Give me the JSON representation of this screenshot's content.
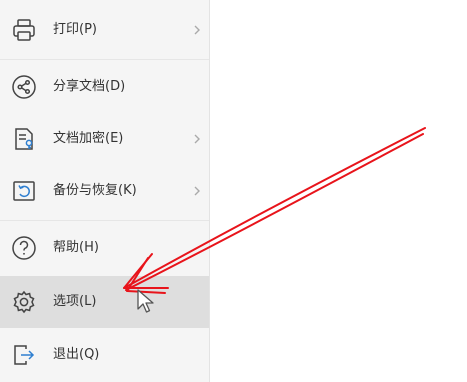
{
  "menu": {
    "items": [
      {
        "label": "打印(P)",
        "icon": "printer-icon",
        "has_submenu": true
      },
      {
        "label": "分享文档(D)",
        "icon": "share-icon",
        "has_submenu": false
      },
      {
        "label": "文档加密(E)",
        "icon": "document-encrypt-icon",
        "has_submenu": true
      },
      {
        "label": "备份与恢复(K)",
        "icon": "backup-restore-icon",
        "has_submenu": true
      },
      {
        "label": "帮助(H)",
        "icon": "help-icon",
        "has_submenu": false
      },
      {
        "label": "选项(L)",
        "icon": "gear-icon",
        "has_submenu": false,
        "highlighted": true
      },
      {
        "label": "退出(Q)",
        "icon": "exit-icon",
        "has_submenu": false
      }
    ]
  },
  "annotation": {
    "color": "#e8141b",
    "target": "选项(L)"
  }
}
